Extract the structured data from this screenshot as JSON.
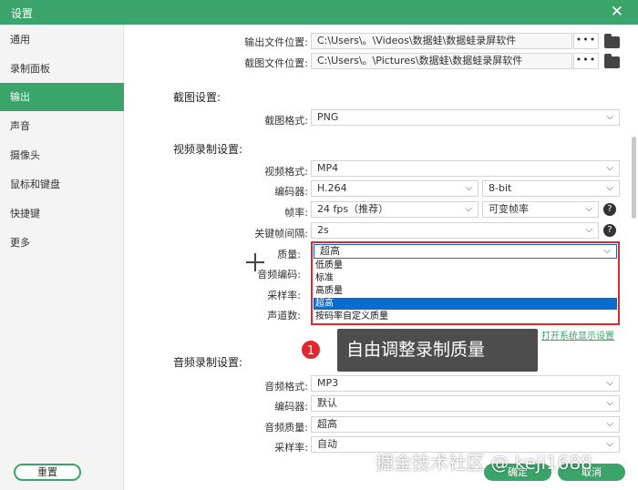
{
  "title": "设置",
  "sidebar": {
    "items": [
      {
        "label": "通用"
      },
      {
        "label": "录制面板"
      },
      {
        "label": "输出"
      },
      {
        "label": "声音"
      },
      {
        "label": "摄像头"
      },
      {
        "label": "鼠标和键盘"
      },
      {
        "label": "快捷键"
      },
      {
        "label": "更多"
      }
    ],
    "reset_label": "重置"
  },
  "output": {
    "file_location_label": "输出文件位置:",
    "file_location_value": "C:\\Users\\。\\Videos\\数据蛙\\数据蛙录屏软件",
    "screenshot_location_label": "截图文件位置:",
    "screenshot_location_value": "C:\\Users\\。\\Pictures\\数据蛙\\数据蛙录屏软件",
    "browse_label": "•••"
  },
  "screenshot": {
    "section_title": "截图设置:",
    "format_label": "截图格式:",
    "format_value": "PNG"
  },
  "video": {
    "section_title": "视频录制设置:",
    "format_label": "视频格式:",
    "format_value": "MP4",
    "encoder_label": "编码器:",
    "encoder_value": "H.264",
    "bitdepth_value": "8-bit",
    "fps_label": "帧率:",
    "fps_value": "24 fps（推荐）",
    "fps_mode_value": "可变帧率",
    "keyframe_label": "关键帧间隔:",
    "keyframe_value": "2s",
    "quality_label": "质量:",
    "quality_value": "超高",
    "audio_encoder_label": "音频编码:",
    "sample_rate_label": "采样率:",
    "channels_label": "声道数:",
    "quality_options": [
      "低质量",
      "标准",
      "高质量",
      "超高",
      "按码率自定义质量"
    ],
    "open_display_settings": "打开系统显示设置",
    "help_icon_text": "?"
  },
  "audio": {
    "section_title": "音频录制设置:",
    "format_label": "音频格式:",
    "format_value": "MP3",
    "encoder_label": "编码器:",
    "encoder_value": "默认",
    "quality_label": "音频质量:",
    "quality_value": "超高",
    "sample_rate_label": "采样率:",
    "sample_rate_value": "自动"
  },
  "annotation": {
    "badge": "1",
    "text": "自由调整录制质量"
  },
  "footer": {
    "ok_label": "确定",
    "cancel_label": "取消"
  },
  "watermark": "掘金技术社区 @ keji1688",
  "colors": {
    "accent": "#3aa46a",
    "highlight": "#e0262f",
    "selected": "#0a6bd0"
  }
}
